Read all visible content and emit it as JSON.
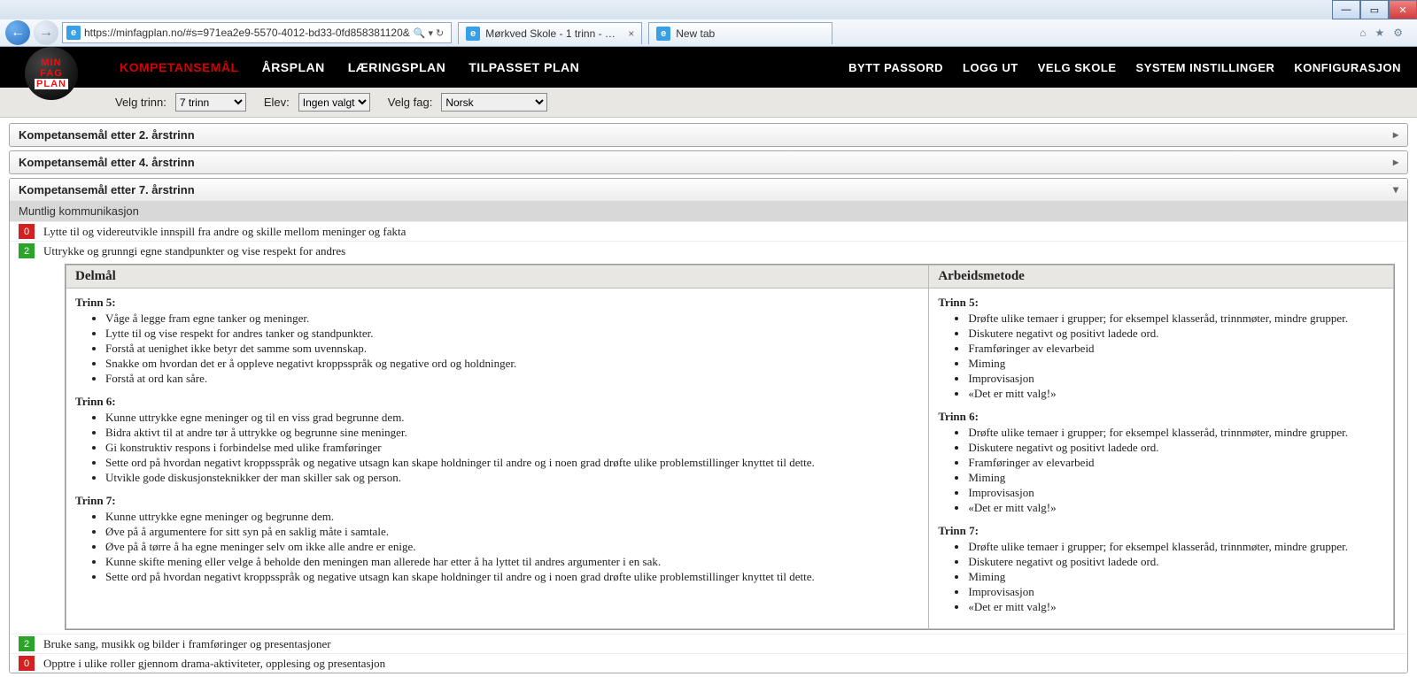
{
  "browser": {
    "url": "https://minfagplan.no/#s=971ea2e9-5570-4012-bd33-0fd858381120&",
    "tab1": "Mørkved Skole - 1 trinn - U...",
    "tab2": "New tab"
  },
  "nav": {
    "main": [
      "KOMPETANSEMÅL",
      "ÅRSPLAN",
      "LÆRINGSPLAN",
      "TILPASSET PLAN"
    ],
    "right": [
      "BYTT PASSORD",
      "LOGG UT",
      "VELG SKOLE",
      "SYSTEM INSTILLINGER",
      "KONFIGURASJON"
    ]
  },
  "filters": {
    "trinn_label": "Velg trinn:",
    "trinn_value": "7 trinn",
    "elev_label": "Elev:",
    "elev_value": "Ingen valgt",
    "fag_label": "Velg fag:",
    "fag_value": "Norsk"
  },
  "panels": {
    "p2": "Kompetansemål etter 2. årstrinn",
    "p4": "Kompetansemål etter 4. årstrinn",
    "p7": "Kompetansemål etter 7. årstrinn",
    "sub": "Muntlig kommunikasjon"
  },
  "goals": {
    "g1": {
      "num": "0",
      "text": "Lytte til og videreutvikle innspill fra andre og skille mellom meninger og fakta"
    },
    "g2": {
      "num": "2",
      "text": "Uttrykke og grunngi egne standpunkter og vise respekt for andres"
    },
    "g3": {
      "num": "2",
      "text": "Bruke sang, musikk og bilder i framføringer og presentasjoner"
    },
    "g4": {
      "num": "0",
      "text": "Opptre i ulike roller gjennom drama-aktiviteter, opplesing og presentasjon"
    }
  },
  "detail": {
    "h_delmal": "Delmål",
    "h_metode": "Arbeidsmetode",
    "t5": "Trinn 5:",
    "t6": "Trinn 6:",
    "t7": "Trinn 7:",
    "d5": [
      "Våge å legge fram egne tanker og meninger.",
      "Lytte til og vise respekt for andres tanker og standpunkter.",
      "Forstå at uenighet ikke betyr det samme som uvennskap.",
      "Snakke om hvordan det er å oppleve negativt kroppsspråk og negative ord og holdninger.",
      "Forstå at ord kan såre."
    ],
    "d6": [
      "Kunne uttrykke egne meninger og til en viss grad begrunne dem.",
      "Bidra aktivt til at andre tør å uttrykke og begrunne sine meninger.",
      "Gi konstruktiv respons i forbindelse med ulike framføringer",
      "Sette ord på hvordan negativt kroppsspråk og negative utsagn kan skape holdninger til andre og i noen grad drøfte ulike problemstillinger knyttet til dette.",
      "Utvikle gode diskusjonsteknikker der man skiller sak og person."
    ],
    "d7": [
      "Kunne uttrykke egne meninger og begrunne dem.",
      "Øve på å argumentere for sitt syn på en saklig måte i samtale.",
      "Øve på å tørre å ha egne meninger selv om ikke alle andre er enige.",
      "Kunne skifte mening eller velge å beholde den meningen man allerede har etter å ha lyttet til andres argumenter i en sak.",
      "Sette ord på hvordan negativt kroppsspråk og negative utsagn kan skape holdninger til andre og i noen grad drøfte ulike problemstillinger knyttet til dette."
    ],
    "m5": [
      "Drøfte ulike temaer i grupper; for eksempel klasseråd, trinnmøter, mindre grupper.",
      "Diskutere negativt og positivt ladede ord.",
      "Framføringer av elevarbeid",
      "Miming",
      "Improvisasjon",
      "«Det er mitt valg!»"
    ],
    "m6": [
      "Drøfte ulike temaer i grupper; for eksempel klasseråd, trinnmøter, mindre grupper.",
      "Diskutere negativt og positivt ladede ord.",
      "Framføringer av elevarbeid",
      "Miming",
      "Improvisasjon",
      "«Det er mitt valg!»"
    ],
    "m7": [
      "Drøfte ulike temaer i grupper; for eksempel klasseråd, trinnmøter, mindre grupper.",
      "Diskutere negativt og positivt ladede ord.",
      "Miming",
      "Improvisasjon",
      "«Det er mitt valg!»"
    ]
  }
}
